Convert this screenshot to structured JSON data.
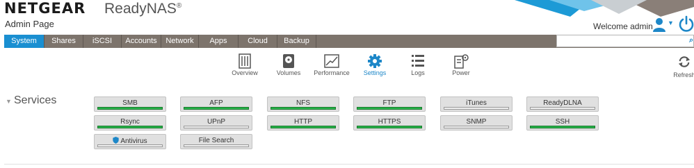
{
  "header": {
    "brand": "NETGEAR",
    "product": "ReadyNAS",
    "product_mark": "®",
    "subtitle": "Admin Page",
    "welcome": "Welcome admin"
  },
  "nav": {
    "tabs": [
      {
        "label": "System",
        "active": true
      },
      {
        "label": "Shares"
      },
      {
        "label": "iSCSI"
      },
      {
        "label": "Accounts"
      },
      {
        "label": "Network"
      },
      {
        "label": "Apps"
      },
      {
        "label": "Cloud"
      },
      {
        "label": "Backup"
      }
    ]
  },
  "toolbar": {
    "items": [
      {
        "label": "Overview",
        "icon": "overview-icon"
      },
      {
        "label": "Volumes",
        "icon": "volumes-icon"
      },
      {
        "label": "Performance",
        "icon": "performance-icon"
      },
      {
        "label": "Settings",
        "icon": "settings-icon",
        "active": true
      },
      {
        "label": "Logs",
        "icon": "logs-icon"
      },
      {
        "label": "Power",
        "icon": "power-settings-icon"
      }
    ],
    "refresh_label": "Refresh"
  },
  "services": {
    "title": "Services",
    "items": [
      {
        "name": "SMB",
        "enabled": true
      },
      {
        "name": "AFP",
        "enabled": true
      },
      {
        "name": "NFS",
        "enabled": true
      },
      {
        "name": "FTP",
        "enabled": true
      },
      {
        "name": "iTunes",
        "enabled": false
      },
      {
        "name": "ReadyDLNA",
        "enabled": false
      },
      {
        "name": "Rsync",
        "enabled": true
      },
      {
        "name": "UPnP",
        "enabled": false
      },
      {
        "name": "HTTP",
        "enabled": true
      },
      {
        "name": "HTTPS",
        "enabled": true
      },
      {
        "name": "SNMP",
        "enabled": false
      },
      {
        "name": "SSH",
        "enabled": true
      },
      {
        "name": "Antivirus",
        "enabled": false,
        "icon": "shield-icon"
      },
      {
        "name": "File Search",
        "enabled": false
      }
    ]
  },
  "colors": {
    "accent": "#1a8fd1",
    "nav_bar": "#7d746c",
    "enabled": "#27b44a",
    "disabled": "#efefef"
  }
}
